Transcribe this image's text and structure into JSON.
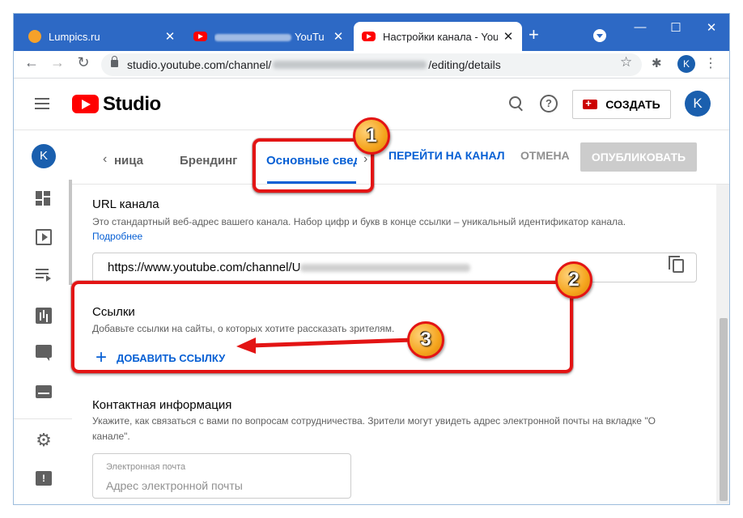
{
  "browser": {
    "tabs": [
      {
        "title": "Lumpics.ru",
        "close": "✕"
      },
      {
        "title": "YouTu",
        "close": "✕"
      },
      {
        "title": "Настройки канала - YouTu",
        "close": "✕"
      }
    ],
    "new_tab": "+",
    "window_controls": {
      "minimize": "—",
      "maximize": "☐",
      "close": "✕"
    },
    "address": {
      "prefix": "studio.youtube.com/channel/",
      "suffix": "/editing/details"
    },
    "profile_initial": "K"
  },
  "studio_header": {
    "logo_text": "Studio",
    "create_label": "СОЗДАТЬ",
    "help_glyph": "?",
    "avatar_initial": "K"
  },
  "left_nav": {
    "avatar_initial": "K",
    "icons": [
      "dashboard-icon",
      "content-icon",
      "playlists-icon",
      "analytics-icon",
      "comments-icon",
      "subtitles-icon",
      "settings-icon",
      "feedback-icon"
    ],
    "feedback_glyph": "!",
    "settings_glyph": "⚙"
  },
  "customization_tabs": {
    "prev_chevron": "‹",
    "next_chevron": "›",
    "tabs": [
      "ница",
      "Брендинг",
      "Основные свед"
    ],
    "active_index": 2
  },
  "actions": {
    "go_to_channel": "ПЕРЕЙТИ НА КАНАЛ",
    "cancel": "ОТМЕНА",
    "publish": "ОПУБЛИКОВАТЬ"
  },
  "url_section": {
    "title": "URL канала",
    "description": "Это стандартный веб-адрес вашего канала. Набор цифр и букв в конце ссылки – уникальный идентификатор канала.",
    "more_link": "Подробнее",
    "url_value": "https://www.youtube.com/channel/U"
  },
  "links_section": {
    "title": "Ссылки",
    "description": "Добавьте ссылки на сайты, о которых хотите рассказать зрителям.",
    "add_link": "ДОБАВИТЬ ССЫЛКУ",
    "plus_glyph": "+"
  },
  "contact_section": {
    "title": "Контактная информация",
    "description": "Укажите, как связаться с вами по вопросам сотрудничества. Зрители могут увидеть адрес электронной почты на вкладке \"О канале\".",
    "email_label": "Электронная почта",
    "email_placeholder": "Адрес электронной почты"
  },
  "annotations": {
    "badge1": "1",
    "badge2": "2",
    "badge3": "3",
    "color": "#e31414"
  },
  "colors": {
    "titlebar": "#2d69c5",
    "accent_blue": "#065fd4",
    "youtube_red": "#ff0000",
    "avatar": "#1a5fae"
  }
}
